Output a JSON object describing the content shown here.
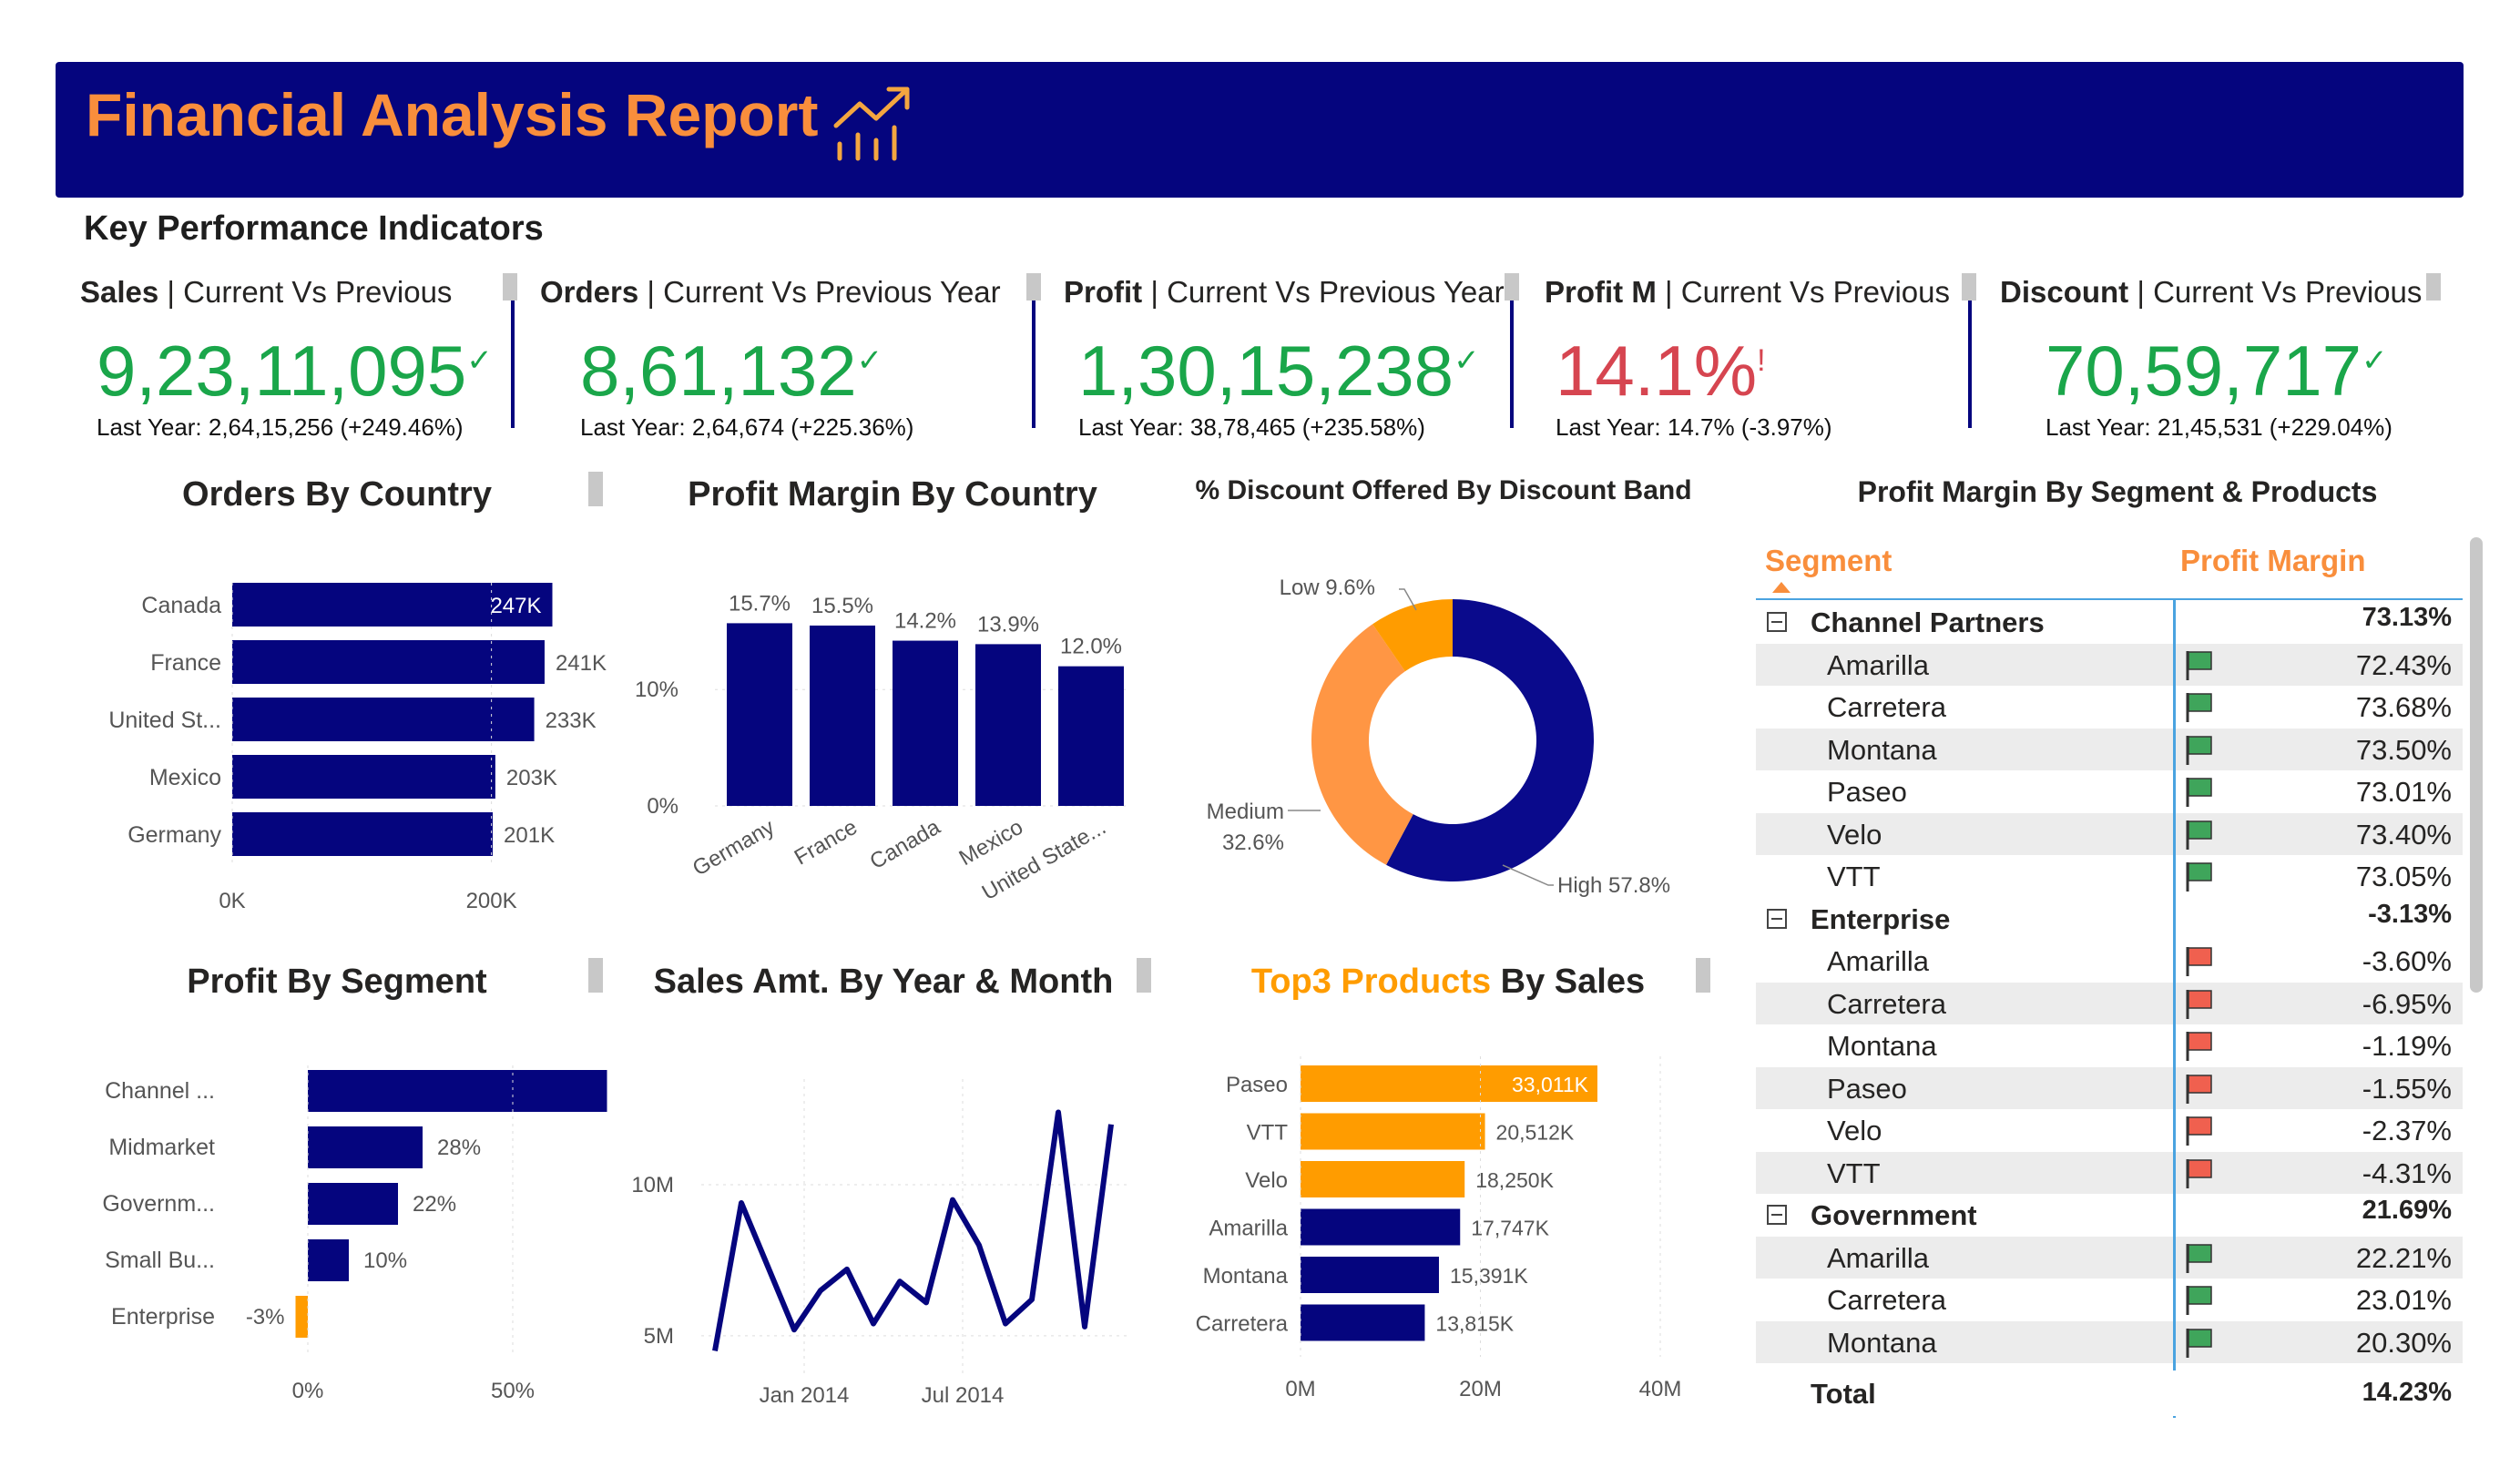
{
  "header": {
    "title": "Financial Analysis Report"
  },
  "kpi_heading": "Key Performance Indicators",
  "kpis": [
    {
      "name_bold": "Sales",
      "name_rest": " | Current Vs Previous",
      "value": "9,23,11,095",
      "indicator": "✓",
      "sub": "Last Year: 2,64,15,256 (+249.46%)",
      "color": "#1aa64a"
    },
    {
      "name_bold": "Orders",
      "name_rest": " | Current Vs Previous Year",
      "value": "8,61,132",
      "indicator": "✓",
      "sub": "Last Year: 2,64,674 (+225.36%)",
      "color": "#1aa64a"
    },
    {
      "name_bold": "Profit",
      "name_rest": " | Current Vs Previous Year",
      "value": "1,30,15,238",
      "indicator": "✓",
      "sub": "Last Year: 38,78,465 (+235.58%)",
      "color": "#1aa64a"
    },
    {
      "name_bold": "Profit M",
      "name_rest": " | Current Vs Previous",
      "value": "14.1%",
      "indicator": "!",
      "sub": "Last Year: 14.7% (-3.97%)",
      "color": "#d64550"
    },
    {
      "name_bold": "Discount",
      "name_rest": " | Current Vs Previous",
      "value": "70,59,717",
      "indicator": "✓",
      "sub": "Last Year: 21,45,531 (+229.04%)",
      "color": "#1aa64a"
    }
  ],
  "charts": {
    "orders_by_country": {
      "title": "Orders By Country"
    },
    "profit_margin_by_country": {
      "title": "Profit Margin By Country"
    },
    "discount_by_band": {
      "title": "% Discount Offered By Discount Band"
    },
    "profit_by_segment": {
      "title": "Profit By Segment"
    },
    "sales_by_month": {
      "title": "Sales Amt. By Year & Month"
    },
    "top3_products": {
      "title_highlight": "Top3 Products",
      "title_rest": " By Sales"
    }
  },
  "matrix": {
    "title": "Profit Margin By Segment & Products",
    "col_segment": "Segment",
    "col_margin": "Profit Margin",
    "rows": [
      {
        "type": "group",
        "label": "Channel Partners",
        "value": "73.13%"
      },
      {
        "type": "item",
        "label": "Amarilla",
        "value": "72.43%",
        "flag": "green"
      },
      {
        "type": "item",
        "label": "Carretera",
        "value": "73.68%",
        "flag": "green"
      },
      {
        "type": "item",
        "label": "Montana",
        "value": "73.50%",
        "flag": "green"
      },
      {
        "type": "item",
        "label": "Paseo",
        "value": "73.01%",
        "flag": "green"
      },
      {
        "type": "item",
        "label": "Velo",
        "value": "73.40%",
        "flag": "green"
      },
      {
        "type": "item",
        "label": "VTT",
        "value": "73.05%",
        "flag": "green"
      },
      {
        "type": "group",
        "label": "Enterprise",
        "value": "-3.13%"
      },
      {
        "type": "item",
        "label": "Amarilla",
        "value": "-3.60%",
        "flag": "red"
      },
      {
        "type": "item",
        "label": "Carretera",
        "value": "-6.95%",
        "flag": "red"
      },
      {
        "type": "item",
        "label": "Montana",
        "value": "-1.19%",
        "flag": "red"
      },
      {
        "type": "item",
        "label": "Paseo",
        "value": "-1.55%",
        "flag": "red"
      },
      {
        "type": "item",
        "label": "Velo",
        "value": "-2.37%",
        "flag": "red"
      },
      {
        "type": "item",
        "label": "VTT",
        "value": "-4.31%",
        "flag": "red"
      },
      {
        "type": "group",
        "label": "Government",
        "value": "21.69%"
      },
      {
        "type": "item",
        "label": "Amarilla",
        "value": "22.21%",
        "flag": "green"
      },
      {
        "type": "item",
        "label": "Carretera",
        "value": "23.01%",
        "flag": "green"
      },
      {
        "type": "item",
        "label": "Montana",
        "value": "20.30%",
        "flag": "green"
      }
    ],
    "total_label": "Total",
    "total_value": "14.23%"
  },
  "colors": {
    "navy": "#05057e",
    "orange": "#f98e3c",
    "amber": "#ff9c00",
    "green": "#1aa64a",
    "red": "#d64550"
  },
  "chart_data": [
    {
      "type": "bar",
      "orientation": "horizontal",
      "categories": [
        "Canada",
        "France",
        "United St...",
        "Mexico",
        "Germany"
      ],
      "values": [
        247,
        241,
        233,
        203,
        201
      ],
      "data_labels": [
        "247K",
        "241K",
        "233K",
        "203K",
        "201K"
      ],
      "x_ticks": [
        "0K",
        "200K"
      ],
      "xlim": [
        0,
        260
      ]
    },
    {
      "type": "bar",
      "categories": [
        "Germany",
        "France",
        "Canada",
        "Mexico",
        "United State..."
      ],
      "values": [
        15.7,
        15.5,
        14.2,
        13.9,
        12.0
      ],
      "data_labels": [
        "15.7%",
        "15.5%",
        "14.2%",
        "13.9%",
        "12.0%"
      ],
      "y_ticks": [
        "0%",
        "10%"
      ],
      "ylim": [
        0,
        18
      ]
    },
    {
      "type": "pie",
      "donut": true,
      "slices": [
        {
          "label": "High 57.8%",
          "value": 57.8,
          "color": "#0a0a8c"
        },
        {
          "label": "Medium\n32.6%",
          "value": 32.6,
          "color": "#ff9644"
        },
        {
          "label": "Low 9.6%",
          "value": 9.6,
          "color": "#ff9c00"
        }
      ]
    },
    {
      "type": "bar",
      "orientation": "horizontal",
      "categories": [
        "Channel ...",
        "Midmarket",
        "Governm...",
        "Small Bu...",
        "Enterprise"
      ],
      "values": [
        73,
        28,
        22,
        10,
        -3
      ],
      "data_labels": [
        "73%",
        "28%",
        "22%",
        "10%",
        "-3%"
      ],
      "x_ticks": [
        "0%",
        "50%"
      ],
      "xlim": [
        -5,
        80
      ]
    },
    {
      "type": "line",
      "x": [
        "2013-09",
        "2013-10",
        "2013-11",
        "2013-12",
        "2014-01",
        "2014-02",
        "2014-03",
        "2014-04",
        "2014-05",
        "2014-06",
        "2014-07",
        "2014-08",
        "2014-09",
        "2014-10",
        "2014-11",
        "2014-12"
      ],
      "values": [
        4.5,
        9.4,
        7.3,
        5.2,
        6.5,
        7.2,
        5.4,
        6.8,
        6.1,
        9.5,
        8.0,
        5.4,
        6.2,
        12.4,
        5.3,
        12.0
      ],
      "y_ticks": [
        "5M",
        "10M"
      ],
      "x_ticks": [
        "Jan 2014",
        "Jul 2014"
      ],
      "ylim": [
        4.0,
        13.5
      ],
      "ylabel_unit": "M"
    },
    {
      "type": "bar",
      "orientation": "horizontal",
      "categories": [
        "Paseo",
        "VTT",
        "Velo",
        "Amarilla",
        "Montana",
        "Carretera"
      ],
      "values": [
        33011,
        20512,
        18250,
        17747,
        15391,
        13815
      ],
      "data_labels": [
        "33,011K",
        "20,512K",
        "18,250K",
        "17,747K",
        "15,391K",
        "13,815K"
      ],
      "highlight_top": 3,
      "x_ticks": [
        "0M",
        "20M",
        "40M"
      ],
      "xlim": [
        0,
        40000
      ]
    }
  ]
}
